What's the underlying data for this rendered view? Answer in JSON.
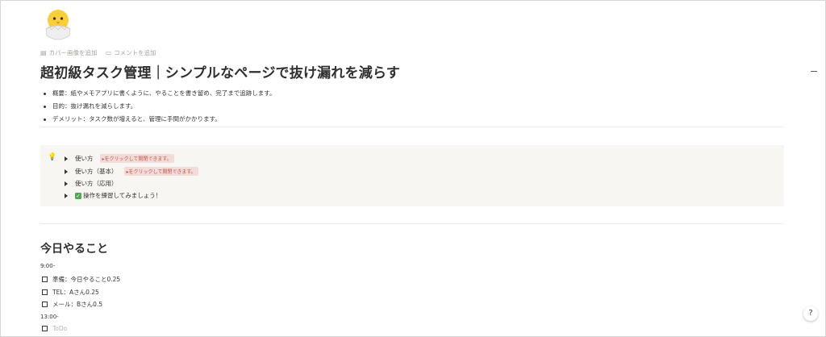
{
  "page": {
    "icon": "hatching-chick-icon",
    "meta": {
      "add_cover": "カバー画像を追加",
      "add_comment": "コメントを追加"
    },
    "title": "超初級タスク管理｜シンプルなページで抜け漏れを減らす",
    "bullets": [
      "概要：紙やメモアプリに書くように、やることを書き留め、完了まで追跡します。",
      "目的：抜け漏れを減らします。",
      "デメリット：タスク数が増えると、管理に手間がかかります。"
    ]
  },
  "callout": {
    "icon": "lightbulb-icon",
    "toggles": [
      {
        "label": "使い方",
        "hint": "▸をクリックして開閉できます。"
      },
      {
        "label": "使い方（基本）",
        "hint": "▸をクリックして開閉できます。"
      },
      {
        "label": "使い方（応用）"
      },
      {
        "label": "操作を練習してみましょう！"
      }
    ]
  },
  "today": {
    "heading": "今日やること",
    "blocks": [
      {
        "time": "9:00-"
      },
      {
        "todo": "準備：今日やること0.25"
      },
      {
        "todo": "TEL：Aさん0.25"
      },
      {
        "todo": "メール：Bさん0.5"
      },
      {
        "time": "13:00-"
      },
      {
        "todo": "ToDo",
        "placeholder": true
      }
    ]
  },
  "help_button": "?"
}
